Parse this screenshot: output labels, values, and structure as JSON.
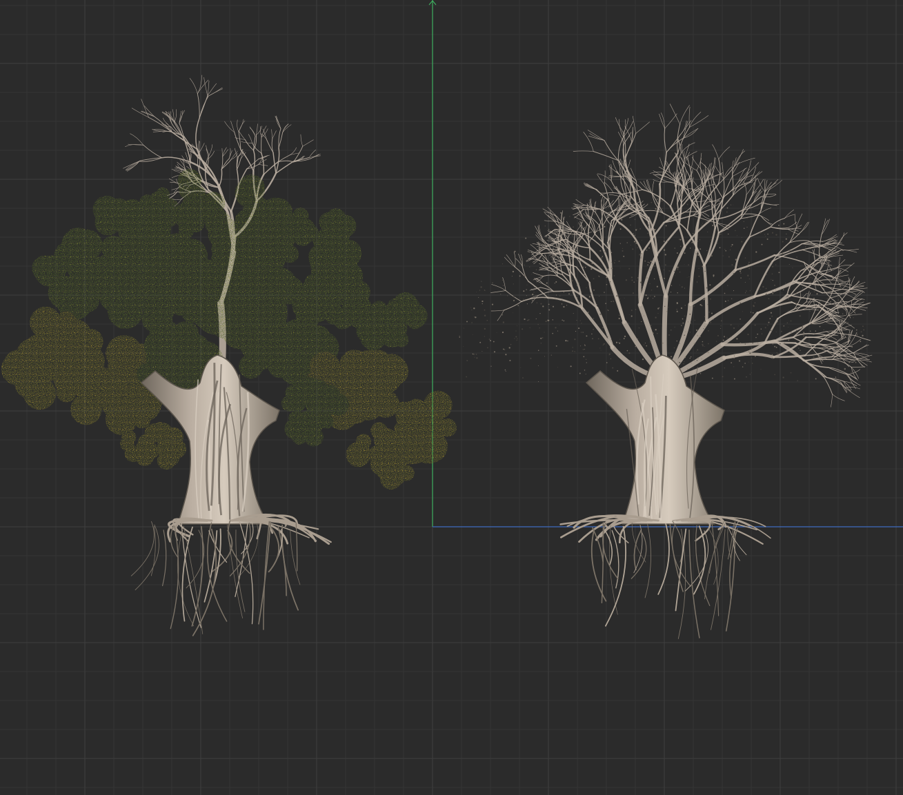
{
  "viewport": {
    "view": "orthographic-front",
    "background_color": "#2b2b2b",
    "grid": true,
    "minor_grid_color": "#343434",
    "major_grid_color": "#3f3f3f",
    "axis_y_color": "#3fae5f",
    "axis_x_color": "#3f6bc0"
  },
  "objects": [
    {
      "name": "tree-with-foliage",
      "foliage": true,
      "foliage_colors": [
        "#4f6226",
        "#6f7a2c",
        "#8b8a2c",
        "#a8972e"
      ],
      "bark_color": "#b9ada0"
    },
    {
      "name": "tree-bare-branches",
      "foliage": false,
      "bark_color": "#b9ada0"
    }
  ]
}
